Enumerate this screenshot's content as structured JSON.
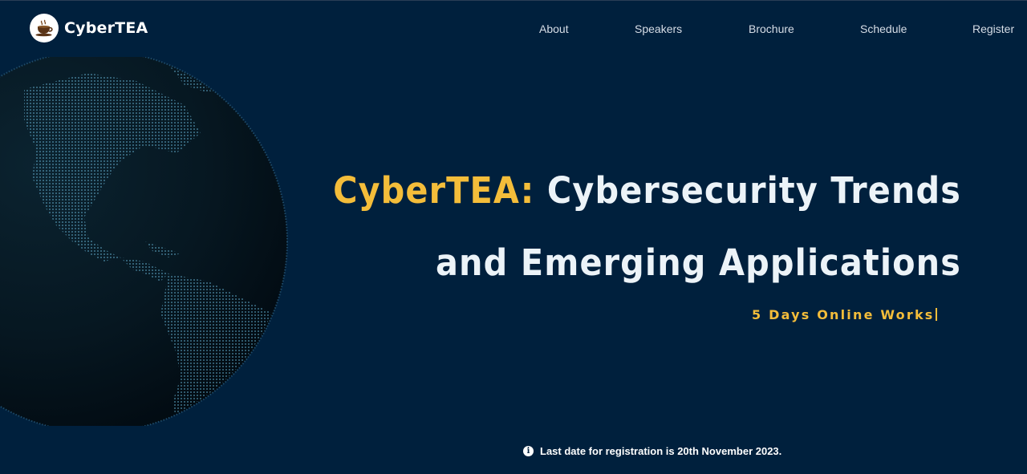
{
  "brand": {
    "name": "CyberTEA",
    "logo_icon": "coffee-cup-icon"
  },
  "nav": {
    "items": [
      {
        "label": "About"
      },
      {
        "label": "Speakers"
      },
      {
        "label": "Brochure"
      },
      {
        "label": "Schedule"
      },
      {
        "label": "Register"
      }
    ]
  },
  "hero": {
    "title_accent": "CyberTEA:",
    "title_rest": "Cybersecurity Trends",
    "title_line2": "and Emerging Applications",
    "subtitle_typed": "5 Days Online Works"
  },
  "notice": {
    "icon": "info-icon",
    "text": "Last date for registration is 20th November 2023."
  },
  "colors": {
    "background": "#00203d",
    "accent": "#f4bd3a",
    "text": "#ecf3f8"
  }
}
